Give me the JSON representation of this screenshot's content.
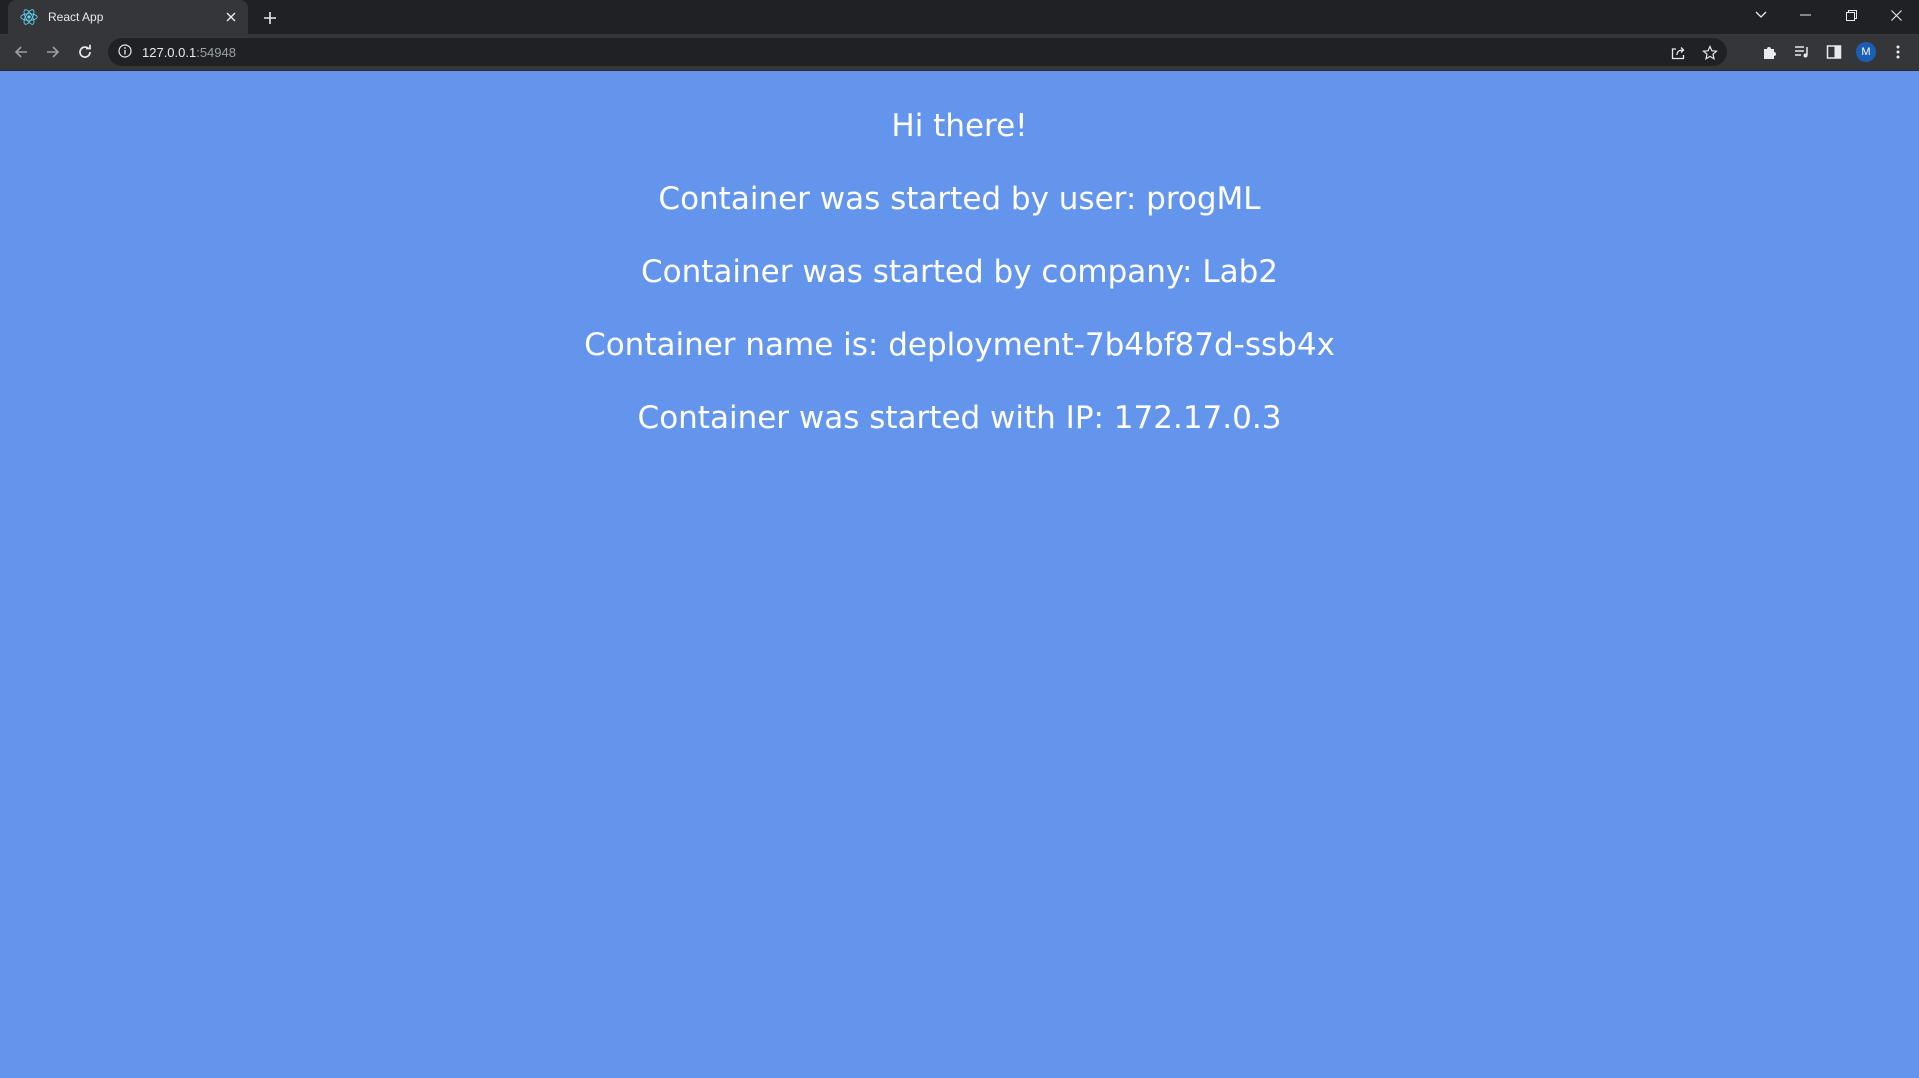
{
  "browser": {
    "tab_title": "React App",
    "url_host": "127.0.0.1",
    "url_port": ":54948",
    "profile_initial": "M",
    "icons": {
      "favicon": "react-logo-icon",
      "tab_close": "close-icon",
      "new_tab": "plus-icon",
      "tab_search": "chevron-down-icon",
      "minimize": "minimize-icon",
      "restore": "restore-icon",
      "close_window": "close-icon",
      "back": "arrow-left-icon",
      "forward": "arrow-right-icon",
      "reload": "reload-icon",
      "site_info": "info-icon",
      "share": "share-icon",
      "bookmark": "star-icon",
      "extensions": "puzzle-icon",
      "media": "playlist-icon",
      "side_panel": "side-panel-icon",
      "menu": "kebab-menu-icon"
    }
  },
  "page": {
    "background": "#6495ed",
    "text_color": "#ffffff",
    "greeting": "Hi there!",
    "user_line": "Container was started by user: progML",
    "company_line": "Container was started by company: Lab2",
    "name_line": "Container name is: deployment-7b4bf87d-ssb4x",
    "ip_line": "Container was started with IP: 172.17.0.3"
  }
}
